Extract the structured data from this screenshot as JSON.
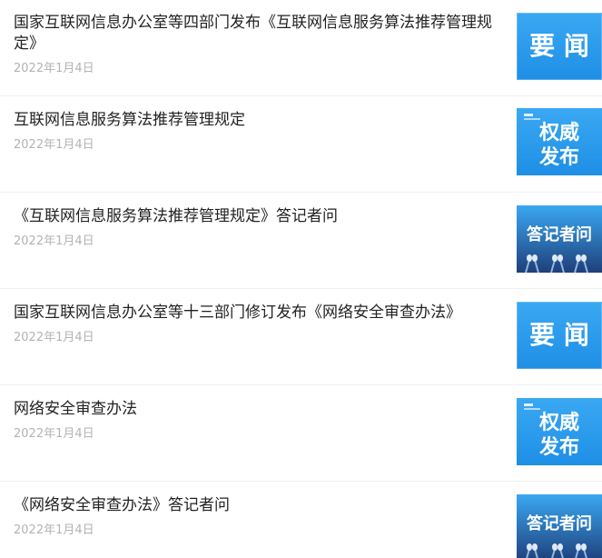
{
  "items": [
    {
      "title": "国家互联网信息办公室等四部门发布《互联网信息服务算法推荐管理规定》",
      "date": "2022年1月4日",
      "thumbnail": {
        "kind": "yaowen",
        "label": "要 闻",
        "icon": "yaowen-thumbnail"
      }
    },
    {
      "title": "互联网信息服务算法推荐管理规定",
      "date": "2022年1月4日",
      "thumbnail": {
        "kind": "quanwei",
        "label_line1": "权威",
        "label_line2": "发布",
        "icon": "quanwei-fabu-thumbnail"
      }
    },
    {
      "title": "《互联网信息服务算法推荐管理规定》答记者问",
      "date": "2022年1月4日",
      "thumbnail": {
        "kind": "dajizhe",
        "label": "答记者问",
        "icon": "press-qa-thumbnail"
      }
    },
    {
      "title": "国家互联网信息办公室等十三部门修订发布《网络安全审查办法》",
      "date": "2022年1月4日",
      "thumbnail": {
        "kind": "yaowen",
        "label": "要 闻",
        "icon": "yaowen-thumbnail"
      }
    },
    {
      "title": "网络安全审查办法",
      "date": "2022年1月4日",
      "thumbnail": {
        "kind": "quanwei",
        "label_line1": "权威",
        "label_line2": "发布",
        "icon": "quanwei-fabu-thumbnail"
      }
    },
    {
      "title": "《网络安全审查办法》答记者问",
      "date": "2022年1月4日",
      "thumbnail": {
        "kind": "dajizhe",
        "label": "答记者问",
        "icon": "press-qa-thumbnail"
      }
    }
  ],
  "colors": {
    "title": "#222222",
    "date": "#b3b3b3",
    "divider": "#f0f0f0",
    "thumb_blue": "#1e8fe6",
    "thumb_blue_light": "#3aa8f2",
    "thumb_navy": "#1f3f7a"
  }
}
